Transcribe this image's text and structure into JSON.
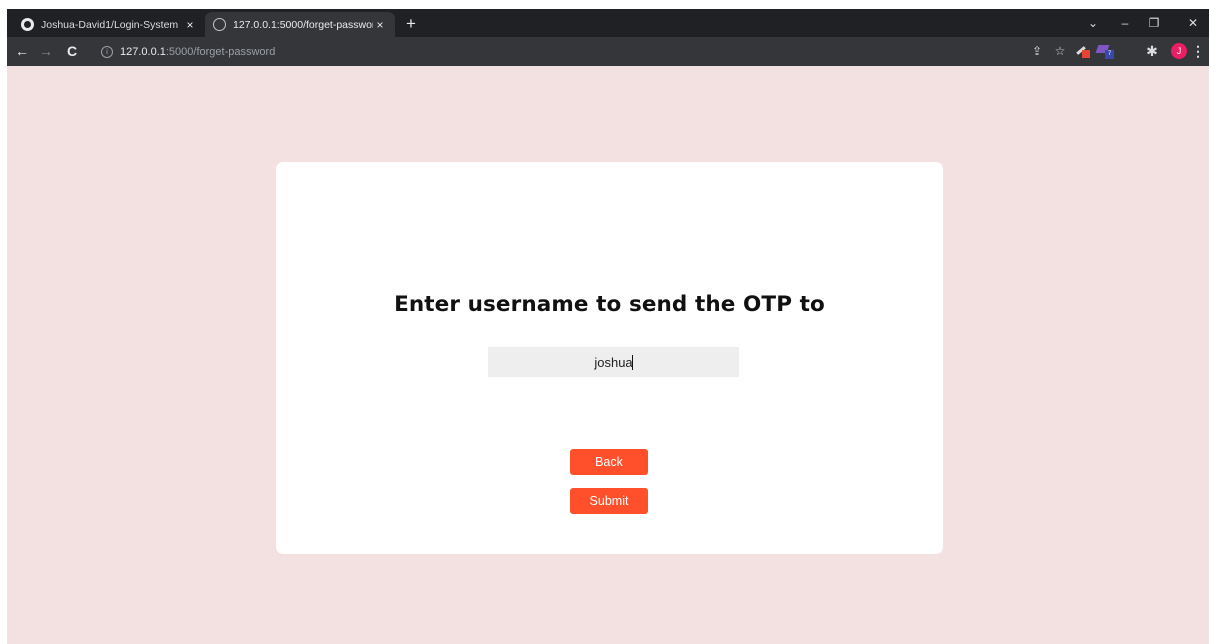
{
  "browser": {
    "tabs": [
      {
        "title": "Joshua-David1/Login-System",
        "close": "×",
        "active": false
      },
      {
        "title": "127.0.0.1:5000/forget-password",
        "close": "×",
        "active": true
      }
    ],
    "new_tab": "+",
    "window_controls": {
      "dropdown": "⌄",
      "minimize": "–",
      "restore": "❐",
      "close": "✕"
    },
    "nav": {
      "back": "←",
      "forward": "→",
      "reload": "C"
    },
    "omnibox": {
      "info": "i",
      "host": "127.0.0.1",
      "path": ":5000/forget-password"
    },
    "toolbar_icons": {
      "share": "⇪",
      "bookmark": "☆",
      "extensions": "✱",
      "menu": "⋮"
    },
    "extension_badge": "7",
    "avatar_initial": "J"
  },
  "page": {
    "background": "#f3e0e0",
    "heading": "Enter username to send the OTP to",
    "username_value": "joshua",
    "back_label": "Back",
    "submit_label": "Submit",
    "accent": "#ff4f2b"
  }
}
